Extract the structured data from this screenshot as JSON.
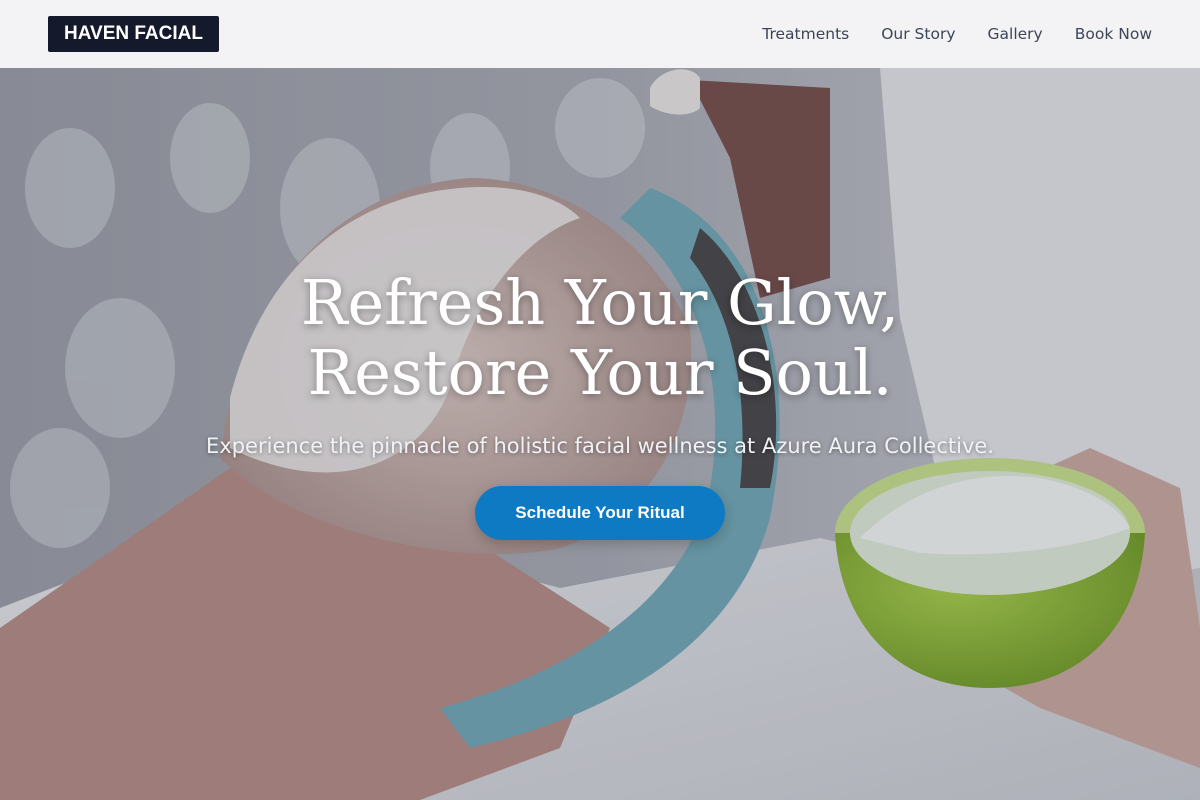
{
  "header": {
    "logo": "HAVEN FACIAL",
    "nav": [
      {
        "label": "Treatments"
      },
      {
        "label": "Our Story"
      },
      {
        "label": "Gallery"
      },
      {
        "label": "Book Now"
      }
    ]
  },
  "hero": {
    "title_line1": "Refresh Your Glow,",
    "title_line2": "Restore Your Soul.",
    "subtitle": "Experience the pinnacle of holistic facial wellness at Azure Aura Collective.",
    "cta_label": "Schedule Your Ritual",
    "image_description": "facial-treatment-photo"
  },
  "colors": {
    "header_bg": "#f3f3f5",
    "logo_bg": "#141a2b",
    "cta_bg": "#0f7ac4"
  }
}
